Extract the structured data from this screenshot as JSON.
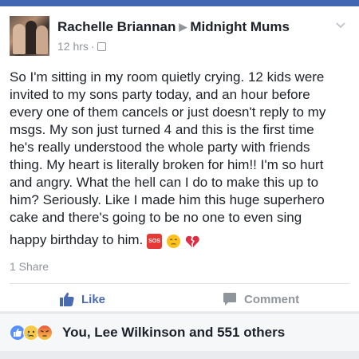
{
  "post": {
    "author": "Rachelle Briannan",
    "group": "Midnight Mums",
    "time": "12 hrs",
    "dot": "·",
    "text_lines": [
      "So I'm sitting in my room quietly crying. 12 kids were",
      "invited to my sons party today, and an hour before",
      "every one of them cancels or just doesn't reply to my",
      "msgs. My son just turned 4 and this is the first time",
      "he's really understood the whole party with friends",
      "thing. My heart is literally broken for him!! I'm so hurt",
      "and angry. What the hell can I do to make this up to",
      "him? Seriously. Like I made him this huge superhero",
      "cake and there's going to be no one to even sing",
      "happy birthday to him."
    ],
    "emojis": [
      "sos-icon",
      "sad-face-icon",
      "broken-heart-icon"
    ],
    "sos_label": "SOS",
    "shares": "1 Share"
  },
  "actions": {
    "like": "Like",
    "comment": "Comment"
  },
  "reactions": {
    "icons": [
      "like-icon",
      "sad-icon",
      "angry-icon"
    ],
    "summary": "You, Lee Wilkinson and 551 others"
  },
  "colors": {
    "fb_blue": "#4267b2",
    "text": "#1d2129",
    "muted": "#90949c",
    "like_blue": "#4b6bb0"
  }
}
